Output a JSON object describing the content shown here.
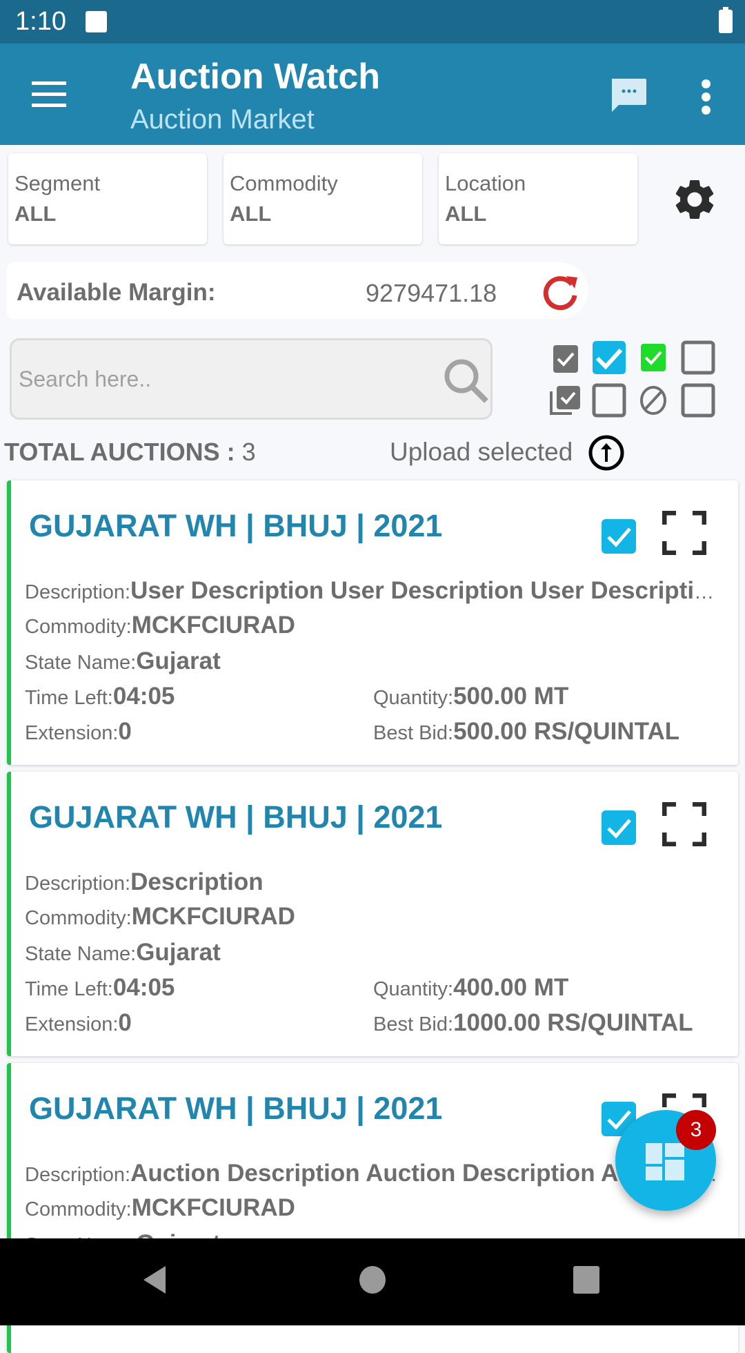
{
  "status_bar": {
    "time": "1:10"
  },
  "app_bar": {
    "title": "Auction Watch",
    "subtitle": "Auction Market"
  },
  "filters": [
    {
      "label": "Segment",
      "value": "ALL"
    },
    {
      "label": "Commodity",
      "value": "ALL"
    },
    {
      "label": "Location",
      "value": "ALL"
    }
  ],
  "margin": {
    "label": "Available Margin:",
    "value": "9279471.18"
  },
  "search": {
    "placeholder": "Search here..",
    "value": ""
  },
  "status_filters": [
    {
      "name": "all-selected",
      "state": "checked",
      "color": "#707070"
    },
    {
      "name": "selected",
      "state": "checked",
      "color": "#12b5e5"
    },
    {
      "name": "won",
      "state": "checked",
      "color": "#1fdc2a"
    },
    {
      "name": "unchecked-1",
      "state": "unchecked",
      "color": "#707070"
    },
    {
      "name": "multi-select",
      "state": "checked",
      "color": "#707070"
    },
    {
      "name": "unchecked-2",
      "state": "unchecked",
      "color": "#707070"
    },
    {
      "name": "blocked",
      "state": "blocked",
      "color": "#707070"
    },
    {
      "name": "unchecked-3",
      "state": "unchecked",
      "color": "#707070"
    }
  ],
  "summary": {
    "total_label": "TOTAL AUCTIONS :",
    "total_value": "3",
    "upload_label": "Upload selected"
  },
  "labels": {
    "description": "Description:",
    "commodity": "Commodity:",
    "state": "State Name:",
    "time_left": "Time Left:",
    "extension": "Extension:",
    "quantity": "Quantity:",
    "best_bid": "Best Bid:"
  },
  "auctions": [
    {
      "title": "GUJARAT WH | BHUJ | 2021",
      "description": "User Description User Description User Description User Description",
      "commodity": "MCKFCIURAD",
      "state": "Gujarat",
      "time_left": "04:05",
      "extension": "0",
      "quantity": "500.00 MT",
      "best_bid": "500.00 RS/QUINTAL",
      "selected": true
    },
    {
      "title": "GUJARAT WH | BHUJ | 2021",
      "description": "Description",
      "commodity": "MCKFCIURAD",
      "state": "Gujarat",
      "time_left": "04:05",
      "extension": "0",
      "quantity": "400.00 MT",
      "best_bid": "1000.00 RS/QUINTAL",
      "selected": true
    },
    {
      "title": "GUJARAT WH | BHUJ | 2021",
      "description": "Auction Description Auction Description  Auction Description",
      "commodity": "MCKFCIURAD",
      "state": "Gujarat",
      "selected": true
    }
  ],
  "fab": {
    "badge": "3"
  },
  "colors": {
    "primary": "#2185ae",
    "status_bar": "#1b6a8e",
    "accent": "#12b5e5",
    "card_border": "#22c34c",
    "badge": "#c50000",
    "refresh": "#d32f2f"
  }
}
